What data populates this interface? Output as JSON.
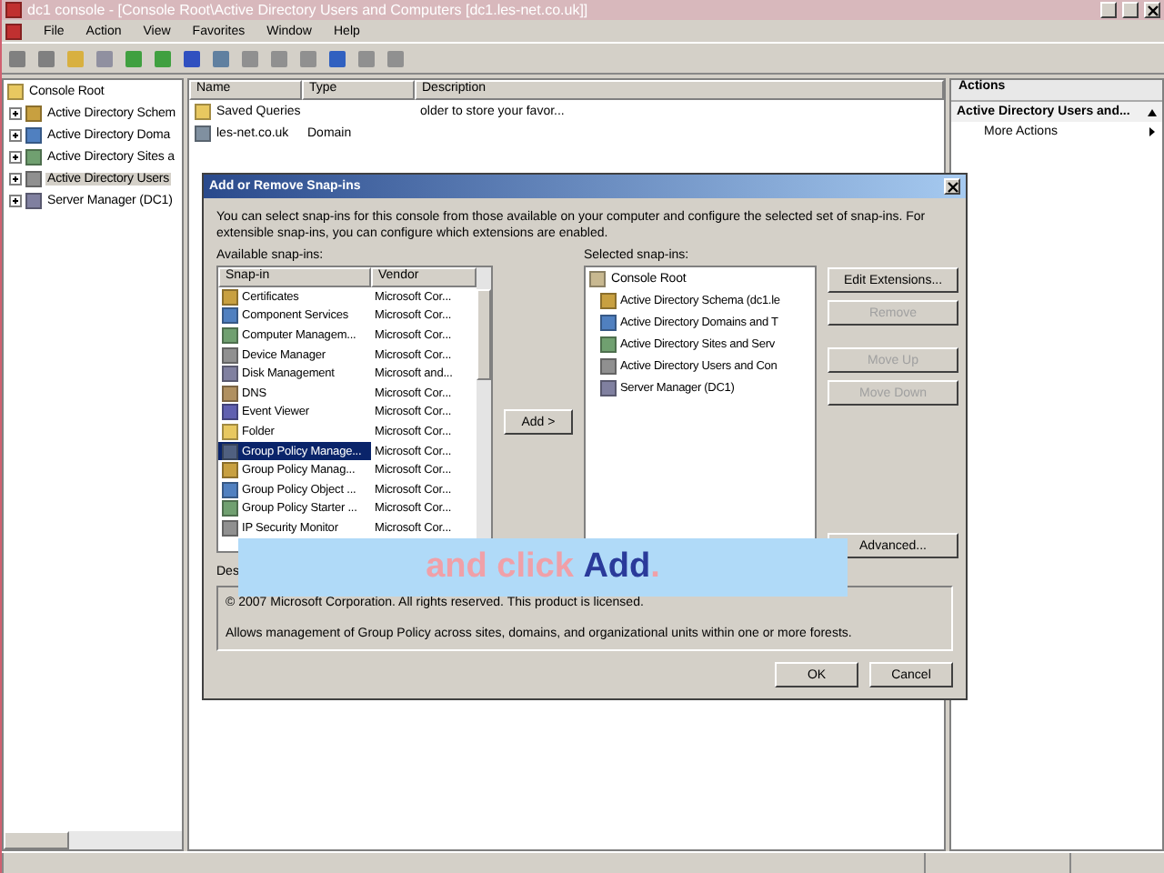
{
  "window": {
    "title": "dc1 console - [Console Root\\Active Directory Users and Computers [dc1.les-net.co.uk]]"
  },
  "menu": [
    "File",
    "Action",
    "View",
    "Favorites",
    "Window",
    "Help"
  ],
  "tree": {
    "root": "Console Root",
    "children": [
      {
        "label": "Active Directory Schem",
        "selected": false
      },
      {
        "label": "Active Directory Doma",
        "selected": false
      },
      {
        "label": "Active Directory Sites a",
        "selected": false
      },
      {
        "label": "Active Directory Users",
        "selected": true
      },
      {
        "label": "Server Manager (DC1)",
        "selected": false
      }
    ]
  },
  "list": {
    "columns": [
      "Name",
      "Type",
      "Description"
    ],
    "rows": [
      {
        "kind": "folder",
        "name": "Saved Queries",
        "type": "",
        "description": "older to store your favor..."
      },
      {
        "kind": "domain",
        "name": "les-net.co.uk",
        "type": "Domain",
        "description": ""
      }
    ]
  },
  "actions": {
    "title": "Actions",
    "section": "Active Directory Users and...",
    "items": [
      "More Actions"
    ]
  },
  "dialog": {
    "title": "Add or Remove Snap-ins",
    "intro": "You can select snap-ins for this console from those available on your computer and configure the selected set of snap-ins. For extensible snap-ins, you can configure which extensions are enabled.",
    "available_label": "Available snap-ins:",
    "columns": [
      "Snap-in",
      "Vendor"
    ],
    "snapins": [
      {
        "name": "Certificates",
        "vendor": "Microsoft Cor...",
        "selected": false
      },
      {
        "name": "Component Services",
        "vendor": "Microsoft Cor...",
        "selected": false
      },
      {
        "name": "Computer Managem...",
        "vendor": "Microsoft Cor...",
        "selected": false
      },
      {
        "name": "Device Manager",
        "vendor": "Microsoft Cor...",
        "selected": false
      },
      {
        "name": "Disk Management",
        "vendor": "Microsoft and...",
        "selected": false
      },
      {
        "name": "DNS",
        "vendor": "Microsoft Cor...",
        "selected": false
      },
      {
        "name": "Event Viewer",
        "vendor": "Microsoft Cor...",
        "selected": false
      },
      {
        "name": "Folder",
        "vendor": "Microsoft Cor...",
        "selected": false
      },
      {
        "name": "Group Policy Manage...",
        "vendor": "Microsoft Cor...",
        "selected": true
      },
      {
        "name": "Group Policy Manag...",
        "vendor": "Microsoft Cor...",
        "selected": false
      },
      {
        "name": "Group Policy Object ...",
        "vendor": "Microsoft Cor...",
        "selected": false
      },
      {
        "name": "Group Policy Starter ...",
        "vendor": "Microsoft Cor...",
        "selected": false
      },
      {
        "name": "IP Security Monitor",
        "vendor": "Microsoft Cor...",
        "selected": false
      }
    ],
    "add_button": "Add >",
    "selected_label": "Selected snap-ins:",
    "selected_tree": {
      "root": "Console Root",
      "children": [
        "Active Directory Schema (dc1.le",
        "Active Directory Domains and T",
        "Active Directory Sites and Serv",
        "Active Directory Users and Con",
        "Server Manager (DC1)"
      ]
    },
    "side_buttons": [
      {
        "label": "Edit Extensions...",
        "disabled": false
      },
      {
        "label": "Remove",
        "disabled": true
      },
      {
        "label": "Move Up",
        "disabled": true
      },
      {
        "label": "Move Down",
        "disabled": true
      },
      {
        "label": "Advanced...",
        "disabled": false
      }
    ],
    "description_label": "Des",
    "description": [
      "© 2007 Microsoft Corporation. All rights reserved. This product is licensed.",
      "Allows management of Group Policy across sites, domains, and organizational units within one or more forests."
    ],
    "buttons": [
      "OK",
      "Cancel"
    ]
  },
  "caption": "and click **Add**."
}
